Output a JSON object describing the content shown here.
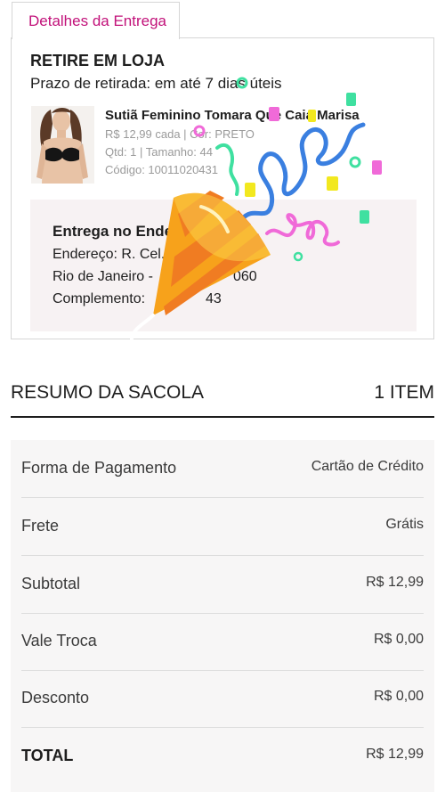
{
  "delivery": {
    "tab_label": "Detalhes da Entrega",
    "pickup_title": "RETIRE EM LOJA",
    "pickup_deadline": "Prazo de retirada: em até 7 dias úteis",
    "product": {
      "name": "Sutiã Feminino Tomara Que Caia Marisa",
      "price_color": "R$ 12,99 cada | Cor: PRETO",
      "qty_size": "Qtd: 1 | Tamanho: 44",
      "code": "Código: 10011020431"
    },
    "address": {
      "title": "Entrega no Endereço",
      "street": "Endereço: R. Cel.",
      "city": "Rio de Janeiro -",
      "city_suffix": "060",
      "complement": "Complemento:",
      "complement_suffix": "43"
    }
  },
  "summary": {
    "title": "RESUMO DA SACOLA",
    "item_count": "1 ITEM",
    "rows": [
      {
        "label": "Forma de Pagamento",
        "value": "Cartão de Crédito"
      },
      {
        "label": "Frete",
        "value": "Grátis"
      },
      {
        "label": "Subtotal",
        "value": "R$ 12,99"
      },
      {
        "label": "Vale Troca",
        "value": "R$ 0,00"
      },
      {
        "label": "Desconto",
        "value": "R$ 0,00"
      },
      {
        "label": "TOTAL",
        "value": "R$ 12,99"
      }
    ]
  },
  "colors": {
    "brand": "#c2127a",
    "confetti_blue": "#3a7fe0",
    "confetti_pink": "#f06ad8",
    "confetti_green": "#3fe0a0",
    "confetti_yellow": "#f2e81f",
    "party_hat": "#f7a21b"
  },
  "icons": [
    "party-popper-icon",
    "confetti-streamer-icon"
  ]
}
